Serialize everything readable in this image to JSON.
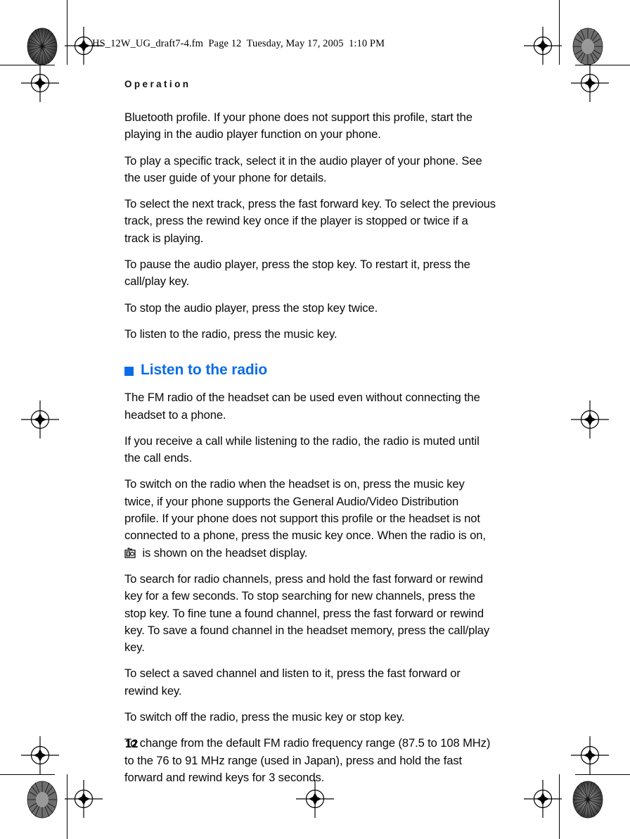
{
  "document": {
    "slug_line": "HS_12W_UG_draft7-4.fm  Page 12  Tuesday, May 17, 2005  1:10 PM",
    "running_head": "Operation",
    "page_number": "12",
    "accent_color": "#0b6ce8"
  },
  "body": {
    "paragraphs_before_heading": [
      "Bluetooth profile. If your phone does not support this profile, start the playing in the audio player function on your phone.",
      "To play a specific track, select it in the audio player of your phone. See the user guide of your phone for details.",
      "To select the next track, press the fast forward key. To select the previous track, press the rewind key once if the player is stopped or twice if a track is playing.",
      "To pause the audio player, press the stop key. To restart it, press the call/play key.",
      "To stop the audio player, press the stop key twice.",
      "To listen to the radio, press the music key."
    ],
    "heading": "Listen to the radio",
    "paragraphs_after_heading_1": [
      "The FM radio of the headset can be used even without connecting the headset to a phone.",
      "If you receive a call while listening to the radio, the radio is muted until the call ends."
    ],
    "paragraph_with_icon": {
      "lead_text": "To switch on the radio when the headset is on, press the music key twice, if your phone supports the General Audio/Video Distribution profile. If your phone does not support this profile or the headset is not connected to a phone, press the music key once. When the radio is on, ",
      "icon": "radio-icon",
      "trailing_text": " is shown on the headset display."
    },
    "paragraphs_after_heading_2": [
      "To search for radio channels, press and hold the fast forward or rewind key for a few seconds. To stop searching for new channels, press the stop key. To fine tune a found channel, press the fast forward or rewind key. To save a found channel in the headset memory, press the call/play key.",
      "To select a saved channel and listen to it, press the fast forward or rewind key.",
      "To switch off the radio, press the music key or stop key.",
      "To change from the default FM radio frequency range (87.5 to 108 MHz) to the 76 to 91 MHz range (used in Japan), press and hold the fast forward and rewind keys for 3 seconds."
    ]
  }
}
